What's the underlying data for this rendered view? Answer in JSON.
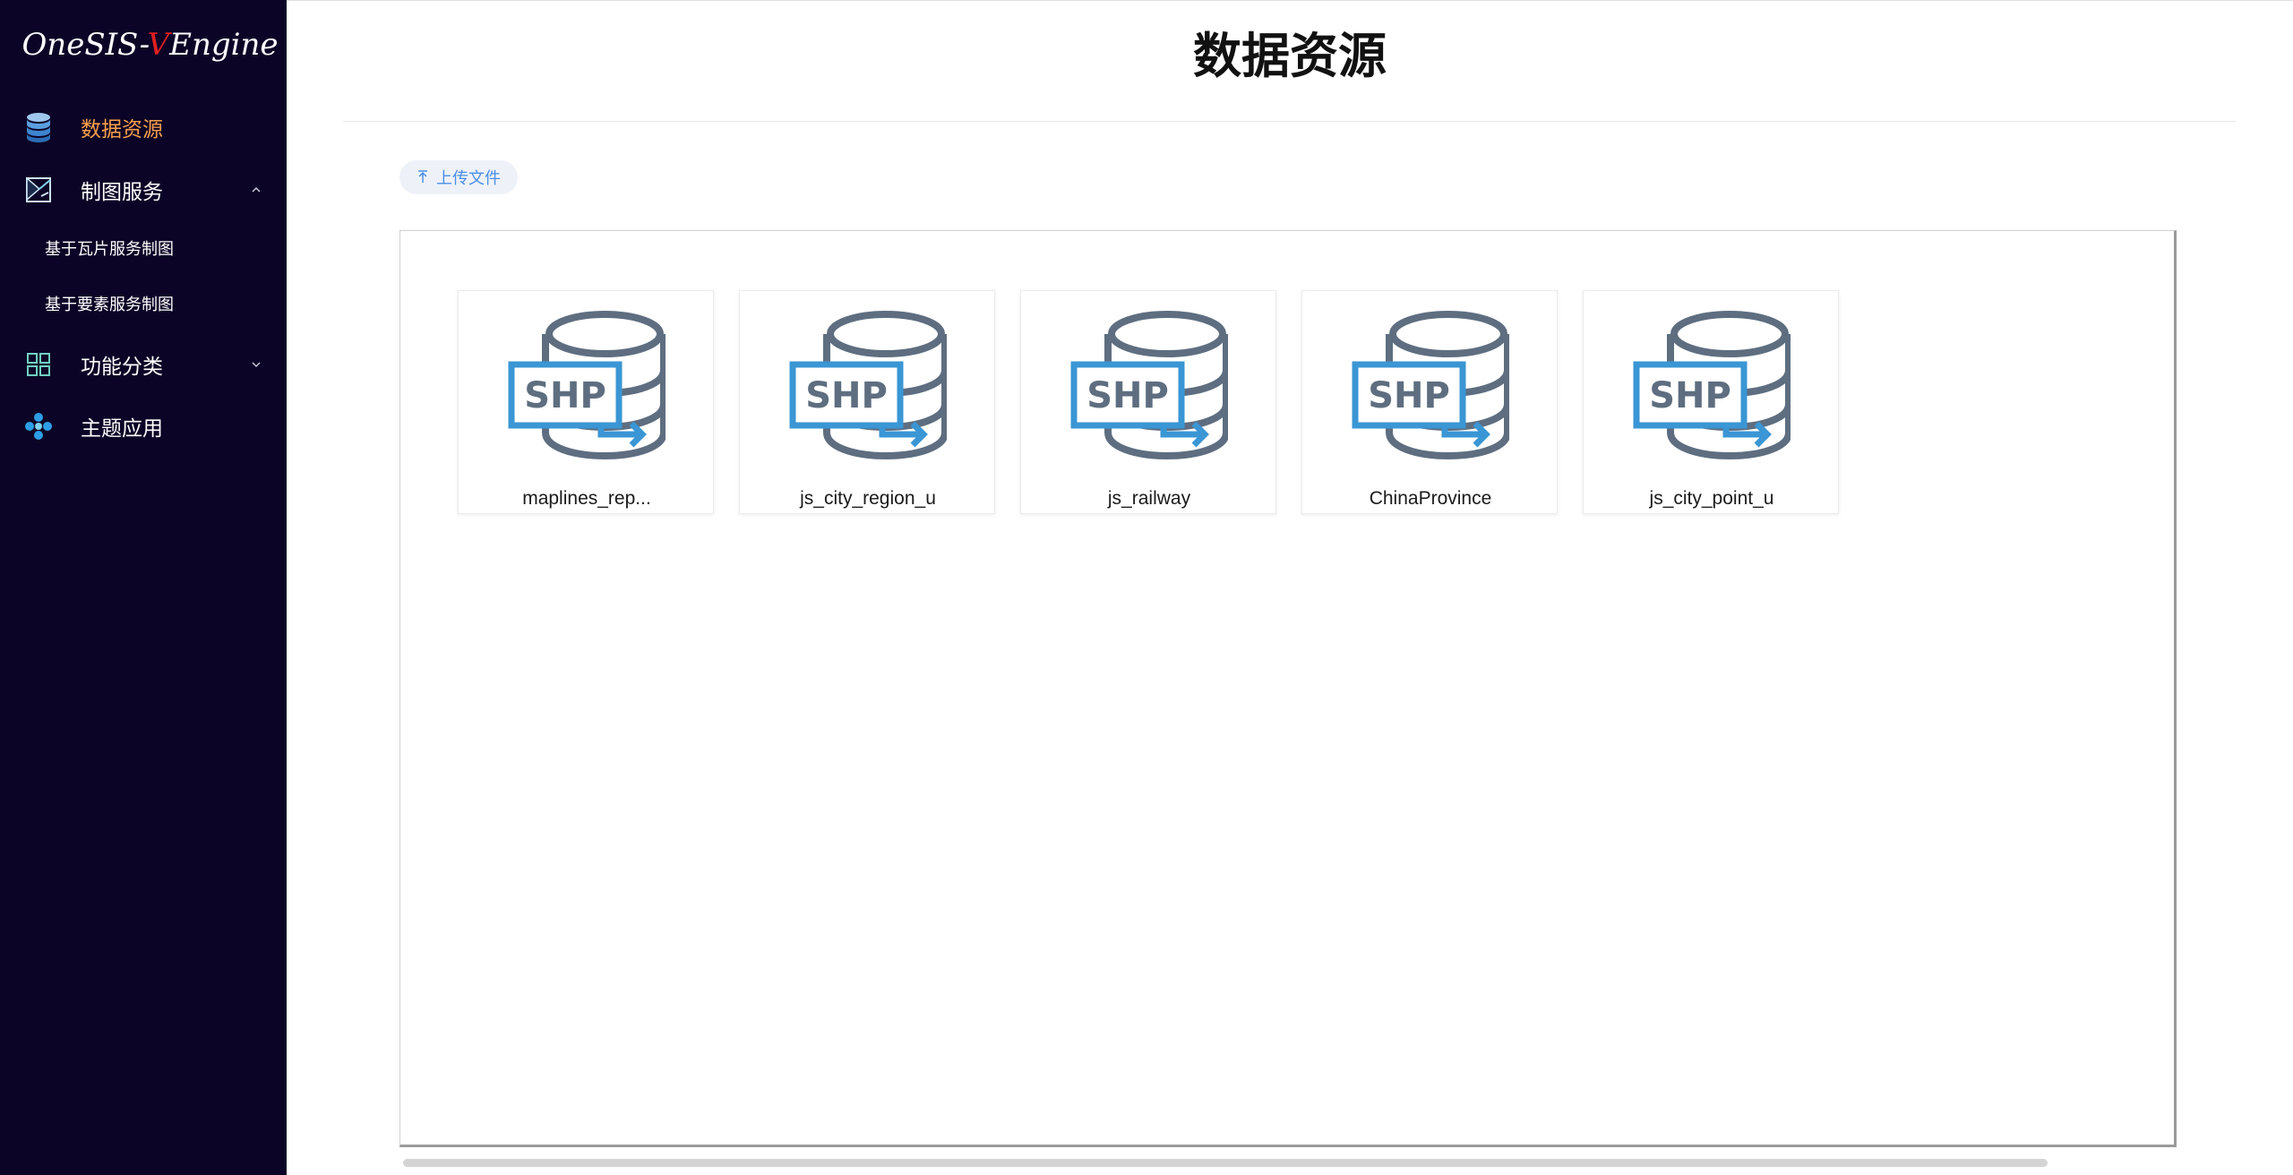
{
  "sidebar": {
    "logo_prefix": "OneSIS-",
    "logo_accent": "V",
    "logo_suffix": "Engine",
    "items": [
      {
        "label": "数据资源",
        "icon": "database-icon",
        "active": true
      },
      {
        "label": "制图服务",
        "icon": "map-chart-icon",
        "expanded": true
      },
      {
        "label": "功能分类",
        "icon": "grid-icon",
        "expanded": false
      },
      {
        "label": "主题应用",
        "icon": "cluster-icon"
      }
    ],
    "sub_items": [
      {
        "label": "基于瓦片服务制图"
      },
      {
        "label": "基于要素服务制图"
      }
    ]
  },
  "main": {
    "title": "数据资源",
    "upload_label": "上传文件",
    "files": [
      {
        "name": "maplines_rep...",
        "icon": "shp-database-icon"
      },
      {
        "name": "js_city_region_u",
        "icon": "shp-database-icon"
      },
      {
        "name": "js_railway",
        "icon": "shp-database-icon"
      },
      {
        "name": "ChinaProvince",
        "icon": "shp-database-icon"
      },
      {
        "name": "js_city_point_u",
        "icon": "shp-database-icon"
      }
    ]
  },
  "colors": {
    "sidebar_bg": "#0c0426",
    "active_text": "#f7a04a",
    "accent_red": "#e02020",
    "link_blue": "#4a8ee8",
    "shp_blue": "#3a96d4",
    "db_gray": "#5e6e80"
  }
}
